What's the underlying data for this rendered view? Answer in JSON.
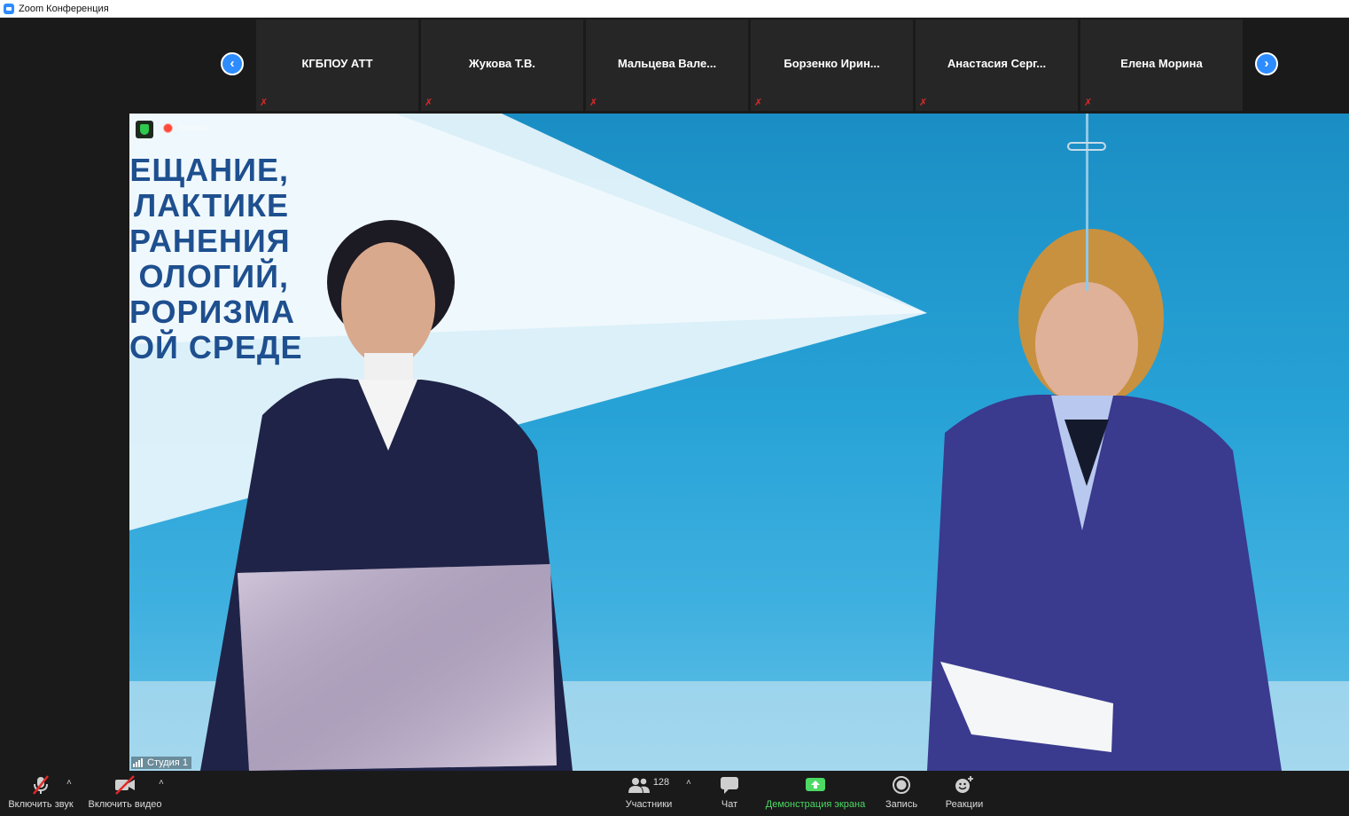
{
  "window": {
    "title": "Zoom Конференция"
  },
  "participants_strip": {
    "tiles": [
      {
        "name": "КГБПОУ АТТ"
      },
      {
        "name": "Жукова Т.В."
      },
      {
        "name": "Мальцева  Вале..."
      },
      {
        "name": "Борзенко  Ирин..."
      },
      {
        "name": "Анастасия  Серг..."
      },
      {
        "name": "Елена Морина"
      }
    ],
    "prev_arrow": "‹",
    "next_arrow": "›",
    "mute_glyph": "✗"
  },
  "main_video": {
    "recording_label": "Запись",
    "banner_lines": [
      "ЕЩАНИЕ,",
      "ЛАКТИКЕ",
      "РАНЕНИЯ",
      "ОЛОГИЙ,",
      "РОРИЗМА",
      "ОЙ СРЕДЕ"
    ],
    "participant_name": "Студия 1"
  },
  "toolbar": {
    "unmute": "Включить звук",
    "start_video": "Включить видео",
    "participants": "Участники",
    "participants_count": "128",
    "chat": "Чат",
    "share_screen": "Демонстрация экрана",
    "record": "Запись",
    "reactions": "Реакции",
    "caret": "˄"
  },
  "colors": {
    "accent": "#2d8cff",
    "share_green": "#4cd964",
    "mute_red": "#e02828"
  }
}
